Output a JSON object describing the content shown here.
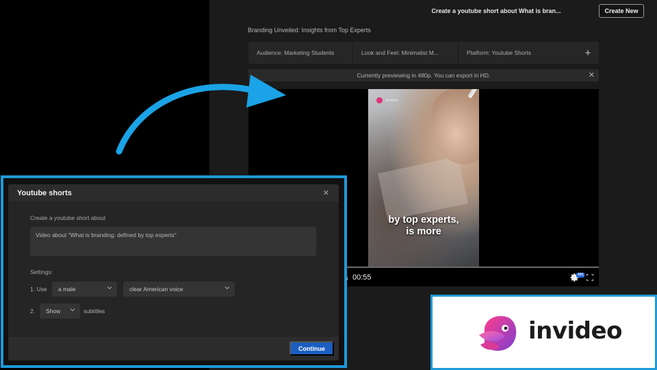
{
  "app": {
    "title": "Create a youtube short about What is bran...",
    "create_new_label": "Create New",
    "video_title": "Branding Unveiled: Insights from Top Experts",
    "chips": [
      "Audience: Marketing Students",
      "Look and Feel: Minimalist M...",
      "Platform: Youtube Shorts"
    ],
    "add_chip_icon": "plus-icon",
    "preview_notice": "Currently previewing in 480p. You can export in HD.",
    "player": {
      "watermark": "invideo",
      "caption_line1": "by top experts,",
      "caption_line2": "is more",
      "time_prefix": "s",
      "time": "00:55",
      "quality_badge": "480",
      "progress": 0
    }
  },
  "dialog": {
    "title": "Youtube shorts",
    "create_label": "Create a youtube short about",
    "prompt_value": "Video about \"What is branding: defined by top experts\"",
    "settings_label": "Settings:",
    "row1_prefix": "1. Use",
    "voice_gender": "a male",
    "voice_accent": "clear American voice",
    "row2_prefix": "2.",
    "subtitles_option": "Show",
    "subtitles_suffix": "subtitles",
    "continue_label": "Continue"
  },
  "logo": {
    "wordmark": "invideo"
  },
  "colors": {
    "accent_blue": "#1e9ad8",
    "continue_blue": "#1a5ec1",
    "brand_pink": "#e0327b",
    "brand_purple": "#7b3fd1"
  }
}
